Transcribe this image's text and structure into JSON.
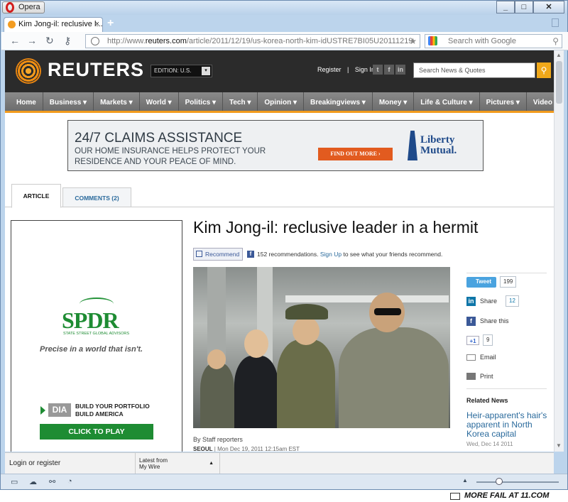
{
  "browser": {
    "app_button": "Opera",
    "tab_title": "Kim Jong-il: reclusive l...",
    "tab_close": "×",
    "new_tab": "+",
    "url_prefix": "http://www.",
    "url_domain": "reuters.com",
    "url_path": "/article/2011/12/19/us-korea-north-kim-idUSTRE7BI05U20111219",
    "search_placeholder": "Search with Google"
  },
  "reuters": {
    "logo": "REUTERS",
    "edition": "EDITION: U.S.",
    "register": "Register",
    "sign_in": "Sign In",
    "search_placeholder": "Search News & Quotes",
    "nav": [
      "Home",
      "Business ▾",
      "Markets ▾",
      "World ▾",
      "Politics ▾",
      "Tech ▾",
      "Opinion ▾",
      "Breakingviews ▾",
      "Money ▾",
      "Life & Culture ▾",
      "Pictures ▾",
      "Video"
    ]
  },
  "top_ad": {
    "headline": "24/7 CLAIMS ASSISTANCE",
    "body": "OUR HOME INSURANCE HELPS PROTECT YOUR RESIDENCE AND YOUR PEACE OF MIND.",
    "button": "FIND OUT MORE ›",
    "brand_line1": "Liberty",
    "brand_line2": "Mutual."
  },
  "page_tabs": {
    "article": "ARTICLE",
    "comments": "COMMENTS (2)"
  },
  "side_ad": {
    "brand": "SPDR",
    "brand_sub": "STATE STREET GLOBAL ADVISORS",
    "tagline": "Precise in a world that isn't.",
    "ticker": "DIA",
    "line1": "BUILD YOUR PORTFOLIO",
    "line2": "BUILD AMERICA",
    "cta": "CLICK TO PLAY"
  },
  "article": {
    "headline": "Kim Jong-il: reclusive leader in a hermit",
    "recommend": "Recommend",
    "rec_count": "152 recommendations.",
    "sign_up": "Sign Up",
    "rec_suffix": "to see what your friends recommend.",
    "byline": "By Staff reporters",
    "dateline_city": "SEOUL",
    "dateline_date": "| Mon Dec 19, 2011 12:15am EST"
  },
  "share": {
    "tweet": "Tweet",
    "tweet_count": "199",
    "linkedin": "Share",
    "linkedin_count": "12",
    "facebook": "Share this",
    "plusone": "+1",
    "plusone_count": "9",
    "email": "Email",
    "print": "Print"
  },
  "related": {
    "heading": "Related News",
    "link": "Heir-apparent's hair's apparent in North Korea capital",
    "date": "Wed, Dec 14 2011"
  },
  "bottom_bar": {
    "login": "Login or register",
    "latest_line1": "Latest from",
    "latest_line2": "My Wire"
  },
  "watermark": "MORE FAIL AT 11.COM"
}
